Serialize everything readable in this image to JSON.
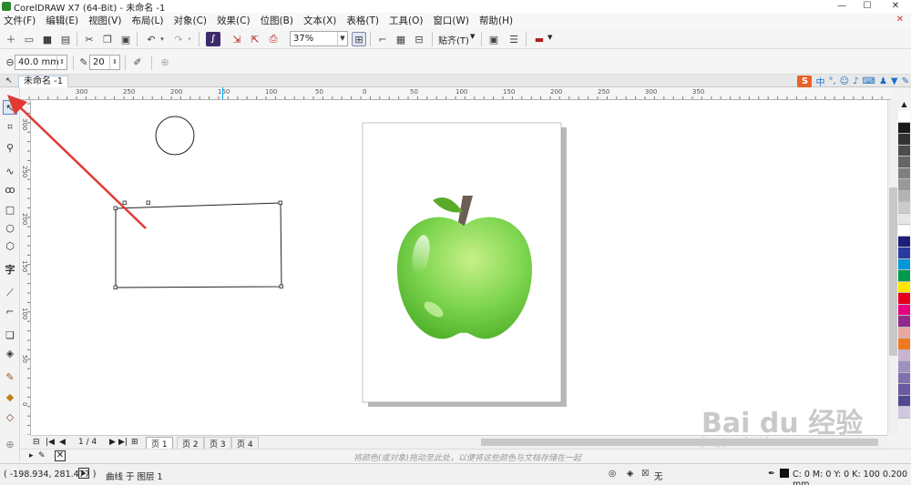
{
  "window": {
    "title": "CorelDRAW X7 (64-Bit) - 未命名 -1",
    "min": "—",
    "max": "☐",
    "close": "✕"
  },
  "menu": [
    "文件(F)",
    "编辑(E)",
    "视图(V)",
    "布局(L)",
    "对象(C)",
    "效果(C)",
    "位图(B)",
    "文本(X)",
    "表格(T)",
    "工具(O)",
    "窗口(W)",
    "帮助(H)"
  ],
  "toolbar": {
    "zoom": "37%",
    "snap": "贴齐(T)"
  },
  "propertybar": {
    "outline_width": "40.0 mm",
    "miter": "20"
  },
  "document_tab": "未命名 -1",
  "ime": {
    "logo": "S",
    "mode": "中"
  },
  "hruler_labels": [
    "300",
    "250",
    "200",
    "150",
    "100",
    "50",
    "0",
    "50",
    "100",
    "150",
    "200",
    "250",
    "300",
    "350"
  ],
  "vruler_labels": [
    "300",
    "250",
    "200",
    "150",
    "100",
    "50",
    "0"
  ],
  "tools": [
    "pick-icon",
    "shape-icon",
    "crop-icon",
    "zoom-icon",
    "freehand-icon",
    "artistic-media-icon",
    "rectangle-icon",
    "ellipse-icon",
    "polygon-icon",
    "text-icon",
    "dimension-icon",
    "connector-icon",
    "shadow-icon",
    "transparency-icon",
    "eyedropper-icon",
    "fill-icon",
    "smart-fill-icon"
  ],
  "palette": [
    "#ffffff",
    "#1a1a1a",
    "#333333",
    "#4d4d4d",
    "#666666",
    "#808080",
    "#999999",
    "#b3b3b3",
    "#cccccc",
    "#e6e6e6",
    "#ffffff",
    "#1d1d7a",
    "#2a3a9e",
    "#0098d9",
    "#009a4d",
    "#ffe600",
    "#e4001a",
    "#e5007f",
    "#912a8c",
    "#e8a8a0",
    "#f07820",
    "#c8b4d0",
    "#a090c0",
    "#8070b0",
    "#6a5aa0",
    "#504890",
    "#d0c8e0"
  ],
  "pages": {
    "counter": "1 / 4",
    "tabs": [
      "页 1",
      "页 2",
      "页 3",
      "页 4"
    ]
  },
  "doc_palette_hint": "将颜色(或对象)拖动至此处，以便将这些颜色与文档存储在一起",
  "status": {
    "coords": "( -198.934, 281.477 )",
    "info": "曲线 于 图层 1",
    "fill": "无",
    "outline": "C: 0 M: 0 Y: 0 K: 100  0.200 mm"
  },
  "watermark": {
    "brand": "Bai du 经验",
    "url": "jingyan.baidu.com"
  },
  "colors": {
    "apple": "#7fd650",
    "leaf": "#5aaa2a",
    "stem": "#6b5e55",
    "arrow": "#e03a32"
  }
}
